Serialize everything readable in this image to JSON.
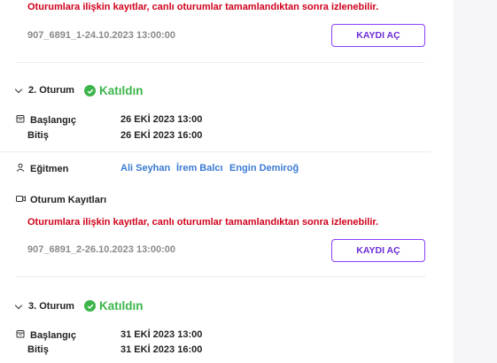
{
  "top_notice": "Oturumlara ilişkin kayıtlar, canlı oturumlar tamamlandıktan sonra izlenebilir.",
  "session1": {
    "recording_file": "907_6891_1-24.10.2023 13:00:00",
    "open_button": "KAYDI AÇ"
  },
  "session2": {
    "title": "2. Oturum",
    "status": "Katıldın",
    "start_label": "Başlangıç",
    "start_value": "26 EKİ 2023 13:00",
    "end_label": "Bitiş",
    "end_value": "26 EKİ 2023 16:00",
    "instructor_label": "Eğitmen",
    "instructors": [
      "Ali Seyhan",
      "İrem Balcı",
      "Engin Demiroğ"
    ],
    "recordings_label": "Oturum Kayıtları",
    "notice": "Oturumlara ilişkin kayıtlar, canlı oturumlar tamamlandıktan sonra izlenebilir.",
    "recording_file": "907_6891_2-26.10.2023 13:00:00",
    "open_button": "KAYDI AÇ"
  },
  "session3": {
    "title": "3. Oturum",
    "status": "Katıldın",
    "start_label": "Başlangıç",
    "start_value": "31 EKİ 2023 13:00",
    "end_label": "Bitiş",
    "end_value": "31 EKİ 2023 16:00"
  },
  "colors": {
    "notice_red": "#d0021b",
    "success_green": "#3bb54a",
    "button_purple": "#8a3ffc",
    "link_blue": "#3a7bd5"
  },
  "icons": {
    "collapse": "chevron-down-icon",
    "status": "check-circle-icon",
    "date": "calendar-icon",
    "instructor": "user-icon",
    "recordings": "video-icon"
  }
}
